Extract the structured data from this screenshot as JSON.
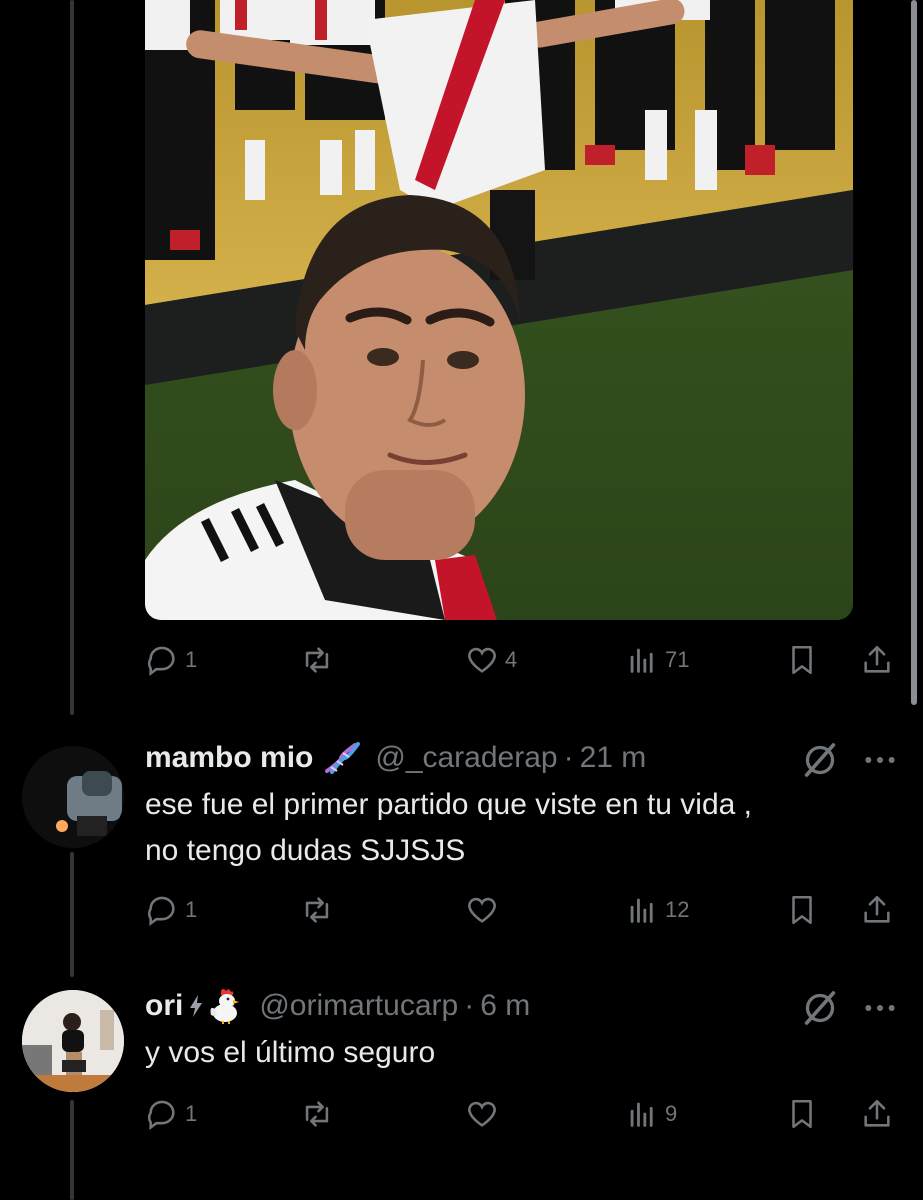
{
  "colors": {
    "background": "#000000",
    "text": "#e7e9ea",
    "muted": "#71767b",
    "divider": "#333639"
  },
  "post": {
    "image_alt": "Selfie of a football player in a white and red jersey on a pitch, teammates celebrating behind",
    "actions": {
      "replies": "1",
      "reposts": "",
      "likes": "4",
      "views": "71"
    }
  },
  "replies": [
    {
      "name": "mambo mio",
      "emoji": "dna-icon",
      "handle": "@_caraderap",
      "time": "21 m",
      "text_lines": [
        "ese fue el primer partido que viste en tu vida ,",
        "no tengo dudas SJJSJS"
      ],
      "actions": {
        "replies": "1",
        "reposts": "",
        "likes": "",
        "views": "12"
      }
    },
    {
      "name": "ori",
      "emoji": "chicken-icon",
      "handle": "@orimartucarp",
      "time": "6 m",
      "text_lines": [
        "y vos el último seguro"
      ],
      "actions": {
        "replies": "1",
        "reposts": "",
        "likes": "",
        "views": "9"
      }
    }
  ]
}
